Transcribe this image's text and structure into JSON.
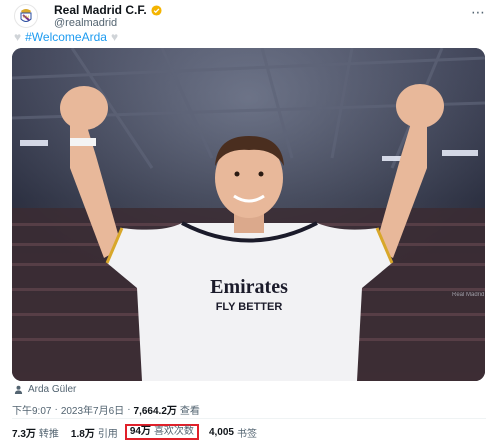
{
  "account": {
    "name": "Real Madrid C.F.",
    "handle": "@realmadrid",
    "verified_color": "#f4b400"
  },
  "post": {
    "hashtag": "#WelcomeArda",
    "image_watermark": "Real Madrid",
    "image_text": {
      "sponsor": "Emirates",
      "slogan": "FLY BETTER"
    },
    "photo_credit": "Arda Güler",
    "time": "下午9:07",
    "date": "2023年7月6日",
    "views_count": "7,664.2万",
    "views_label": "查看"
  },
  "stats": {
    "retweets_count": "7.3万",
    "retweets_label": "转推",
    "quotes_count": "1.8万",
    "quotes_label": "引用",
    "likes_count": "94万",
    "likes_label": "喜欢次数",
    "bookmarks_count": "4,005",
    "bookmarks_label": "书签"
  },
  "icons": [
    "crest-icon",
    "verified-badge-icon",
    "more-icon",
    "heart-icon",
    "person-icon"
  ],
  "colors": {
    "link": "#1d9bf0",
    "highlight": "#e0202a",
    "muted": "#536471"
  }
}
